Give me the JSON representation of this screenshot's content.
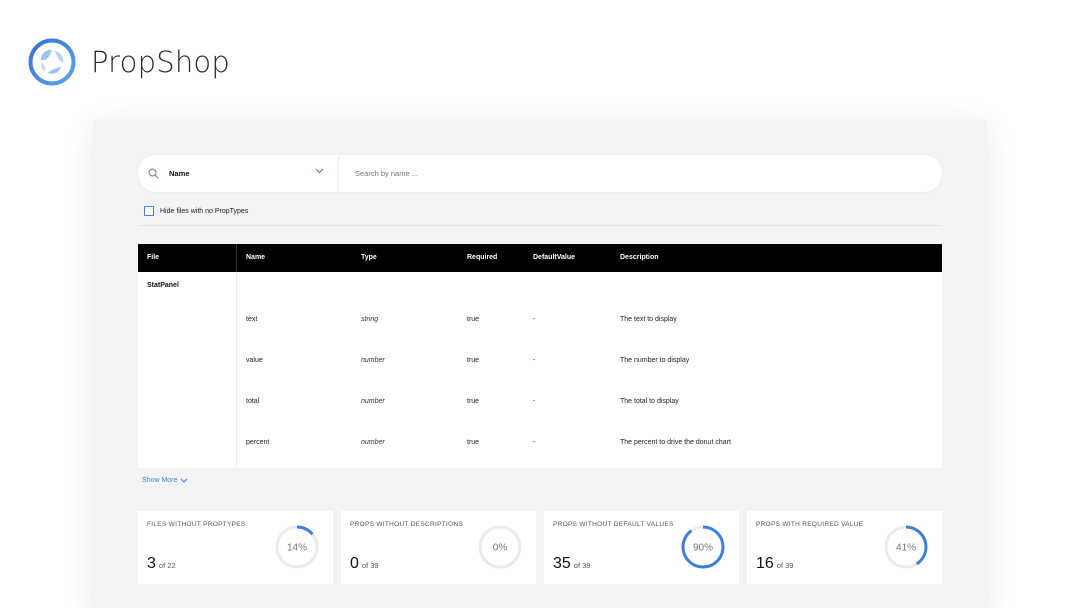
{
  "brand": {
    "name": "PropShop",
    "icon": "propshop-logo"
  },
  "search": {
    "select_label": "Name",
    "placeholder": "Search by name ..."
  },
  "filter": {
    "hide_label": "Hide files with no PropTypes",
    "checked": false
  },
  "table": {
    "columns": [
      "File",
      "Name",
      "Type",
      "Required",
      "DefaultValue",
      "Description"
    ],
    "file": "StatPanel",
    "rows": [
      {
        "name": "text",
        "type": "string",
        "required": "true",
        "default": "-",
        "description": "The text to display"
      },
      {
        "name": "value",
        "type": "number",
        "required": "true",
        "default": "-",
        "description": "The number to display"
      },
      {
        "name": "total",
        "type": "number",
        "required": "true",
        "default": "-",
        "description": "The total to display"
      },
      {
        "name": "percent",
        "type": "number",
        "required": "true",
        "default": "-",
        "description": "The percent to drive the donut chart"
      }
    ]
  },
  "show_more": "Show More",
  "stats": [
    {
      "title": "FILES WITHOUT PROPTYPES",
      "value": "3",
      "of": "of 22",
      "percent": 14,
      "label": "14%"
    },
    {
      "title": "PROPS WITHOUT DESCRIPTIONS",
      "value": "0",
      "of": "of 39",
      "percent": 0,
      "label": "0%"
    },
    {
      "title": "PROPS WITHOUT DEFAULT VALUES",
      "value": "35",
      "of": "of 39",
      "percent": 90,
      "label": "90%"
    },
    {
      "title": "PROPS WITH REQUIRED VALUE",
      "value": "16",
      "of": "of 39",
      "percent": 41,
      "label": "41%"
    }
  ],
  "colors": {
    "accent": "#3d7fe0",
    "track": "#ebebeb",
    "header_bg": "#000000"
  }
}
